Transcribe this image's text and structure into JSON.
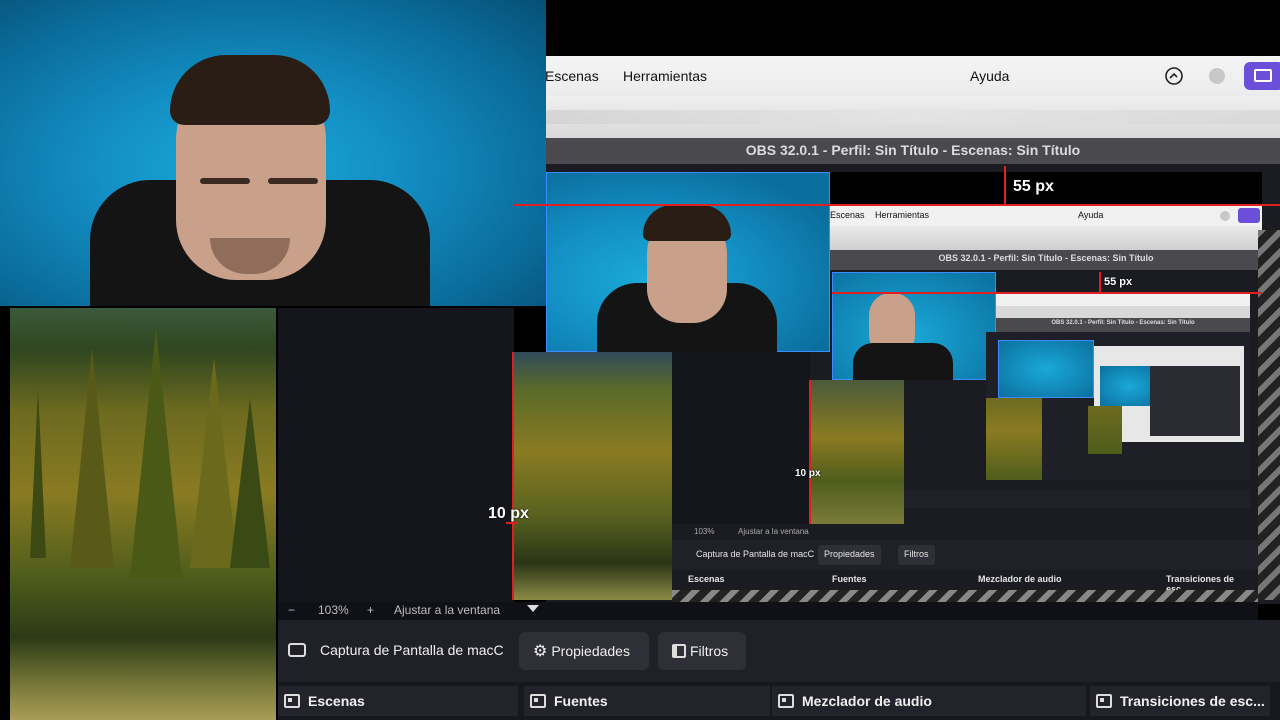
{
  "menu": {
    "items": [
      "Escenas",
      "Herramientas",
      "Ayuda"
    ]
  },
  "obs_title": "OBS 32.0.1 - Perfil: Sin Título - Escenas: Sin Título",
  "guides": {
    "top": "55 px",
    "left": "10 px"
  },
  "nested": {
    "menu": [
      "Escenas",
      "Herramientas",
      "Ayuda"
    ],
    "title": "OBS 32.0.1 - Perfil: Sin Título - Escenas: Sin Título",
    "title_small": "OBS 32.0.1 - Perfil: Sin Título - Escenas: Sin Título",
    "guide_top": "55 px",
    "guide_left": "10 px",
    "zoom": "103%",
    "fit": "Ajustar a la ventana",
    "source": "Captura de Pantalla de macC",
    "properties": "Propiedades",
    "filters": "Filtros",
    "docks": [
      "Escenas",
      "Fuentes",
      "Mezclador de audio",
      "Transiciones de esc..."
    ]
  },
  "toolbar": {
    "minus": "−",
    "zoom": "103%",
    "plus": "+",
    "fit": "Ajustar a la ventana"
  },
  "source_bar": {
    "source_name": "Captura de Pantalla de macC",
    "properties": "Propiedades",
    "filters": "Filtros"
  },
  "docks": [
    "Escenas",
    "Fuentes",
    "Mezclador de audio",
    "Transiciones de esc..."
  ],
  "colors": {
    "accent_purple": "#6b4fd8",
    "guide_red": "#e02020",
    "selection_blue": "#3a8cff",
    "panel_dark": "#202128"
  }
}
